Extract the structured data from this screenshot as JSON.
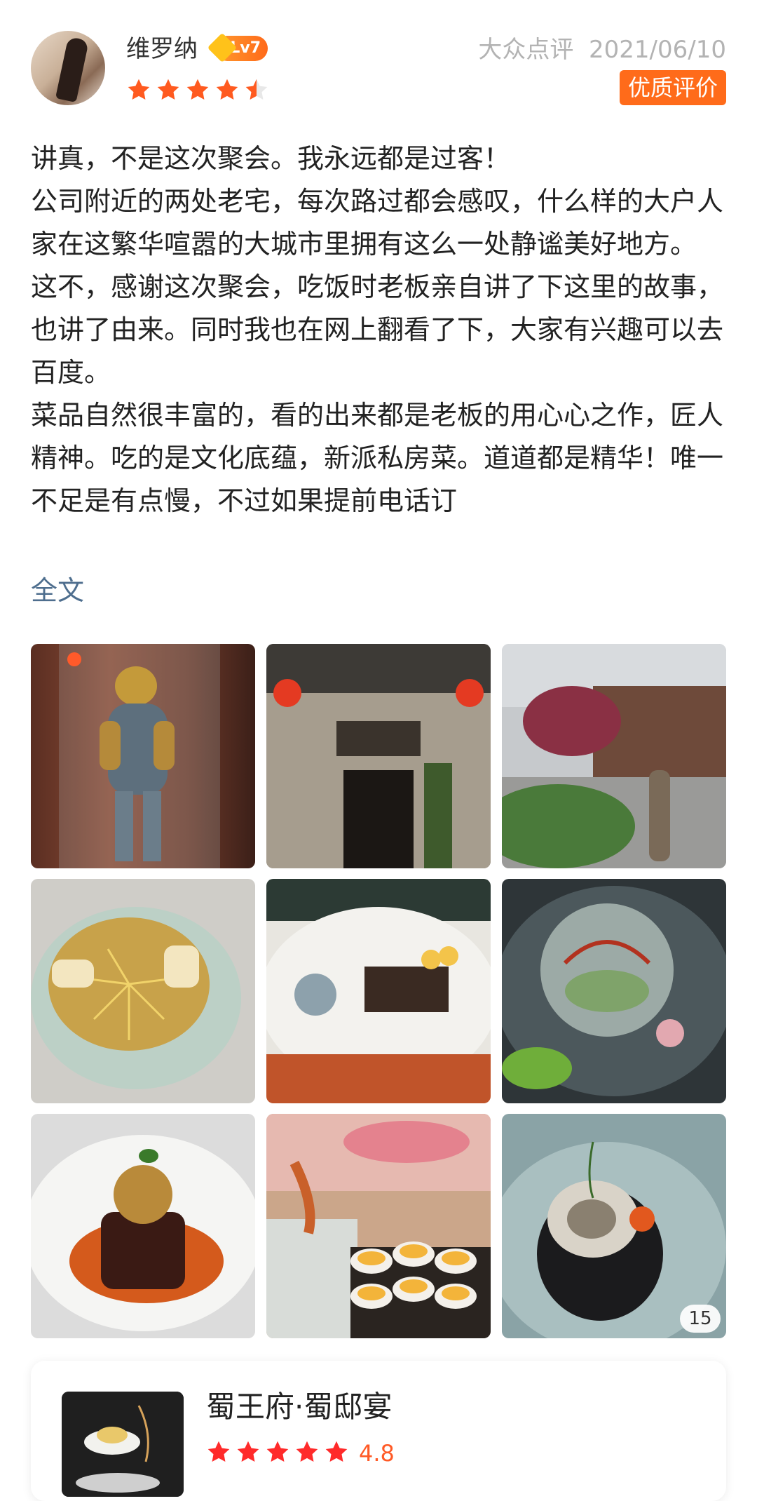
{
  "reviewer": {
    "name": "维罗纳",
    "level": "Lv7",
    "rating_stars": 4.5
  },
  "meta": {
    "source": "大众点评",
    "date": "2021/06/10",
    "badge": "优质评价"
  },
  "review": {
    "paragraphs": [
      "讲真，不是这次聚会。我永远都是过客！",
      "公司附近的两处老宅，每次路过都会感叹，什么样的大户人家在这繁华喧嚣的大城市里拥有这么一处静谧美好地方。",
      "这不，感谢这次聚会，吃饭时老板亲自讲了下这里的故事，也讲了由来。同时我也在网上翻看了下，大家有兴趣可以去百度。",
      "菜品自然很丰富的，看的出来都是老板的用心心之作，匠人精神。吃的是文化底蕴，新派私房菜。道道都是精华！唯一不足是有点慢，不过如果提前电话订"
    ],
    "more_link": "全文"
  },
  "photos": {
    "count_badge": "15"
  },
  "shop": {
    "name": "蜀王府·蜀邸宴",
    "rating": "4.8",
    "rating_stars": 5
  },
  "colors": {
    "accent": "#ff6b1a",
    "star": "#ff5a1f",
    "link": "#4e6e8e"
  }
}
